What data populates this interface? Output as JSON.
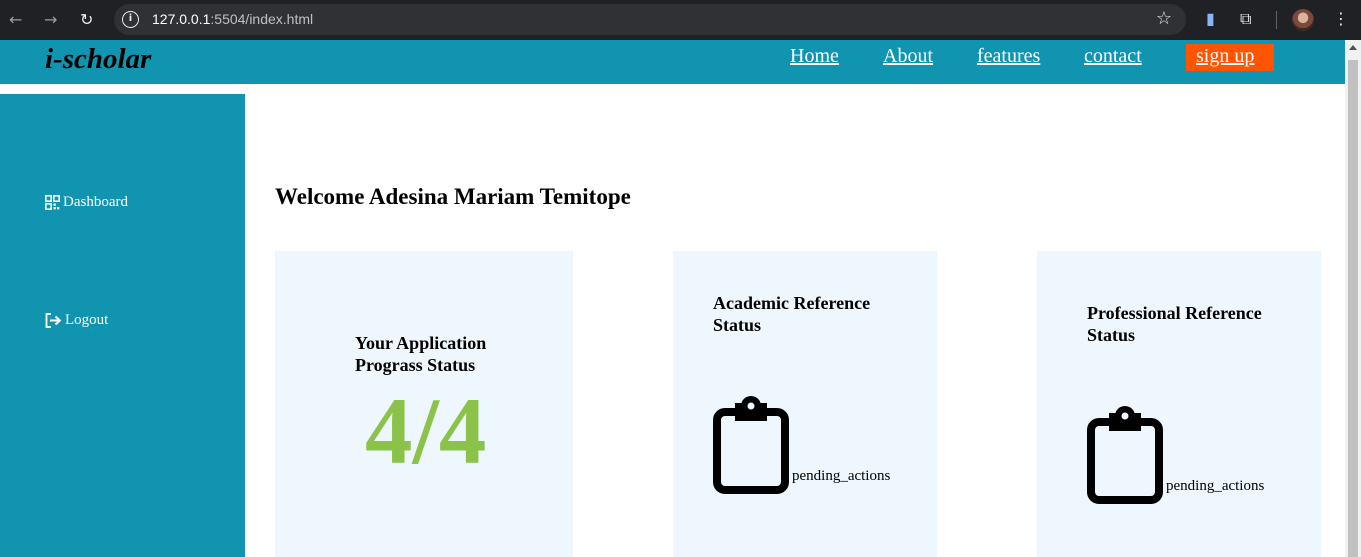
{
  "browser": {
    "url_host": "127.0.0.1",
    "url_path": ":5504/index.html"
  },
  "header": {
    "logo": "i-scholar",
    "nav": [
      "Home",
      "About",
      "features",
      "contact"
    ],
    "signup": "sign up"
  },
  "sidebar": {
    "items": [
      {
        "label": "Dashboard",
        "icon": "dashboard-icon"
      },
      {
        "label": "Logout",
        "icon": "logout-icon"
      }
    ]
  },
  "main": {
    "welcome": "Welcome Adesina Mariam Temitope",
    "cards": [
      {
        "title_line1": "Your Application",
        "title_line2": "Prograss Status",
        "value": "4/4"
      },
      {
        "title_line1": "Academic Reference",
        "title_line2": "Status",
        "icon_text": "pending_actions"
      },
      {
        "title_line1": "Professional Reference",
        "title_line2": "Status",
        "icon_text": "pending_actions"
      }
    ]
  },
  "colors": {
    "brand": "#1194b0",
    "signup": "#ff5500",
    "card_bg": "#eef7fe",
    "progress": "#8bc34a"
  }
}
